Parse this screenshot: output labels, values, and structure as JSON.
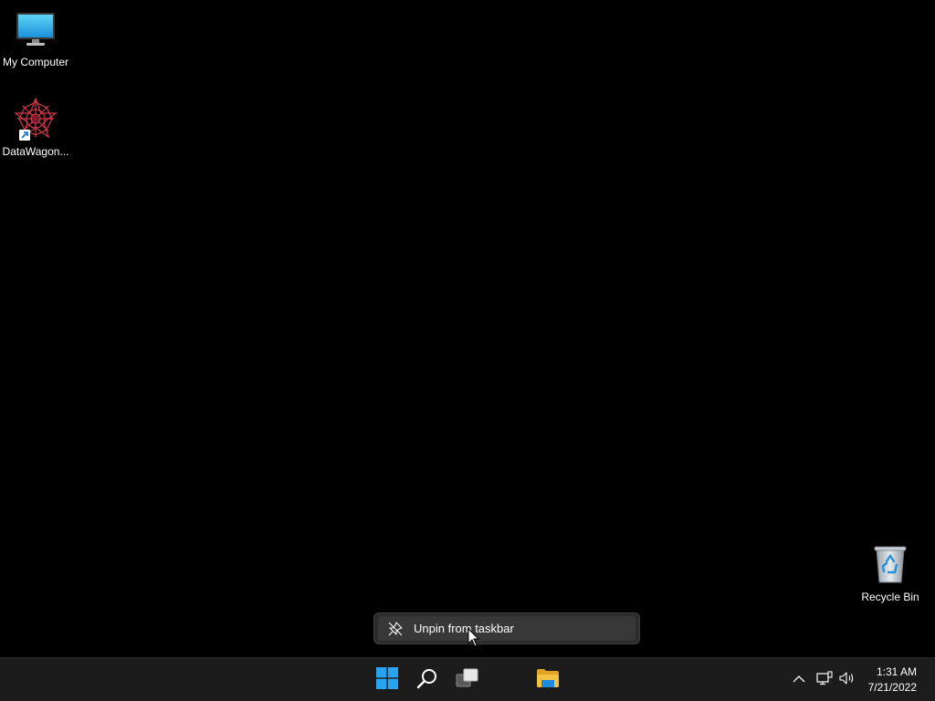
{
  "desktop": {
    "icons": [
      {
        "label": "My Computer",
        "icon": "monitor-icon"
      },
      {
        "label": "DataWagon...",
        "icon": "datawagon-app-icon",
        "shortcut": true
      },
      {
        "label": "Recycle Bin",
        "icon": "recycle-bin-icon"
      }
    ]
  },
  "context_menu": {
    "items": [
      {
        "label": "Unpin from taskbar",
        "icon": "unpin-icon"
      }
    ]
  },
  "taskbar": {
    "buttons": [
      {
        "name": "start",
        "icon": "windows-start-icon"
      },
      {
        "name": "search",
        "icon": "search-icon"
      },
      {
        "name": "task-view",
        "icon": "task-view-icon"
      },
      {
        "name": "file-explorer",
        "icon": "folder-icon"
      }
    ],
    "tray": {
      "icons": [
        "chevron-up-icon",
        "network-icon",
        "volume-icon"
      ],
      "time": "1:31 AM",
      "date": "7/21/2022"
    }
  },
  "colors": {
    "desktop_background": "#000000",
    "taskbar_background": "#1c1c1c",
    "menu_background": "#2c2c2c",
    "accent_blue": "#29a3f0",
    "folder_yellow": "#f5c342"
  }
}
